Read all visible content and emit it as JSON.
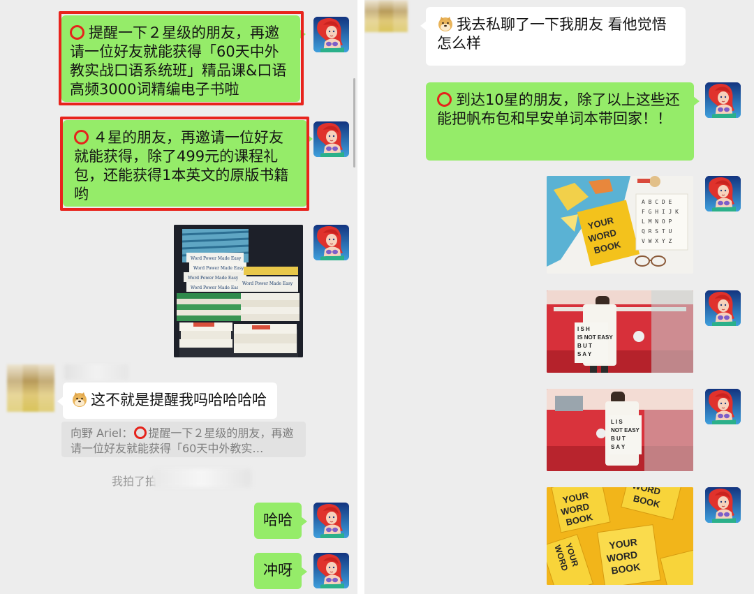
{
  "left": {
    "msg1": "提醒一下２星级的朋友，再邀请一位好友就能获得「60天中外教实战口语系统班」精品课&口语高频3000词精编电子书啦",
    "msg2": "４星的朋友，再邀请一位好友就能获得，除了499元的课程礼包，还能获得1本英文的原版书籍哟",
    "reply_text": "这不就是提醒我吗哈哈哈哈",
    "quote_prefix": "向野 Ariel：",
    "quote_text": "提醒一下２星级的朋友，再邀请一位好友就能获得「60天中外教实…",
    "system_text": "我拍了拍",
    "msg_haha": "哈哈",
    "msg_chongya": "冲呀",
    "book_spine_text": "Word Power Made Easy"
  },
  "right": {
    "friend_msg": "我去私聊了一下我朋友 看他觉悟怎么样",
    "msg_10star": "到达10星的朋友，除了以上这些还能把帆布包和早安单词本带回家！！",
    "notebook_text": "YOUR WORD BOOK",
    "alphabet": [
      "A",
      "B",
      "C",
      "D",
      "E",
      "F",
      "G",
      "H",
      "I",
      "J",
      "K",
      "L",
      "M",
      "N",
      "O",
      "P",
      "Q",
      "R",
      "S",
      "T",
      "U",
      "V",
      "W",
      "X",
      "Y",
      "Z"
    ],
    "tote_text": "ENGLISH IS NOT EASY BUT I SAY"
  },
  "colors": {
    "bubble_green": "#95ec69",
    "highlight_red": "#e8231c",
    "chat_bg": "#ededed"
  },
  "icons": [
    "red-circle-emoji",
    "doge-emoji",
    "mermaid-avatar"
  ]
}
